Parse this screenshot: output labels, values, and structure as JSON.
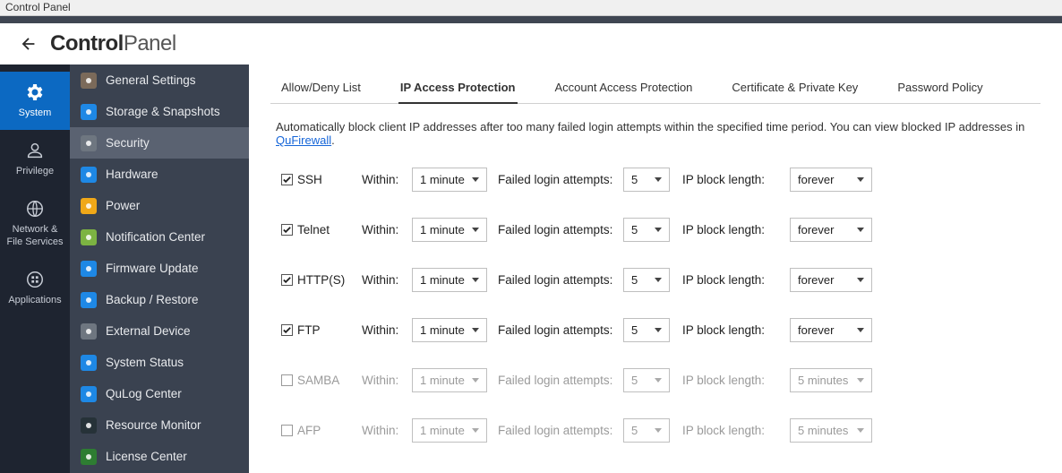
{
  "window_title": "Control Panel",
  "header": {
    "bold": "Control",
    "thin": "Panel"
  },
  "rail": [
    {
      "label": "System",
      "active": true
    },
    {
      "label": "Privilege",
      "active": false
    },
    {
      "label": "Network &\nFile Services",
      "active": false
    },
    {
      "label": "Applications",
      "active": false
    }
  ],
  "subnav": [
    {
      "label": "General Settings",
      "icon_bg": "#7b6a5a"
    },
    {
      "label": "Storage & Snapshots",
      "icon_bg": "#1e88e5"
    },
    {
      "label": "Security",
      "icon_bg": "#6e7680",
      "active": true
    },
    {
      "label": "Hardware",
      "icon_bg": "#1e88e5"
    },
    {
      "label": "Power",
      "icon_bg": "#f0a818"
    },
    {
      "label": "Notification Center",
      "icon_bg": "#7cb342"
    },
    {
      "label": "Firmware Update",
      "icon_bg": "#1e88e5"
    },
    {
      "label": "Backup / Restore",
      "icon_bg": "#1e88e5"
    },
    {
      "label": "External Device",
      "icon_bg": "#6e7680"
    },
    {
      "label": "System Status",
      "icon_bg": "#1e88e5"
    },
    {
      "label": "QuLog Center",
      "icon_bg": "#1e88e5"
    },
    {
      "label": "Resource Monitor",
      "icon_bg": "#263238"
    },
    {
      "label": "License Center",
      "icon_bg": "#2e7d32"
    }
  ],
  "tabs": [
    {
      "label": "Allow/Deny List"
    },
    {
      "label": "IP Access Protection",
      "active": true
    },
    {
      "label": "Account Access Protection"
    },
    {
      "label": "Certificate & Private Key"
    },
    {
      "label": "Password Policy"
    }
  ],
  "description_text": "Automatically block client IP addresses after too many failed login attempts within the specified time period. You can view blocked IP addresses in ",
  "description_link": "QuFirewall",
  "row_labels": {
    "within": "Within:",
    "failed": "Failed login attempts:",
    "block": "IP block length:"
  },
  "protocols": [
    {
      "name": "SSH",
      "checked": true,
      "within": "1 minute",
      "attempts": "5",
      "block": "forever"
    },
    {
      "name": "Telnet",
      "checked": true,
      "within": "1 minute",
      "attempts": "5",
      "block": "forever"
    },
    {
      "name": "HTTP(S)",
      "checked": true,
      "within": "1 minute",
      "attempts": "5",
      "block": "forever"
    },
    {
      "name": "FTP",
      "checked": true,
      "within": "1 minute",
      "attempts": "5",
      "block": "forever"
    },
    {
      "name": "SAMBA",
      "checked": false,
      "within": "1 minute",
      "attempts": "5",
      "block": "5 minutes"
    },
    {
      "name": "AFP",
      "checked": false,
      "within": "1 minute",
      "attempts": "5",
      "block": "5 minutes"
    }
  ]
}
